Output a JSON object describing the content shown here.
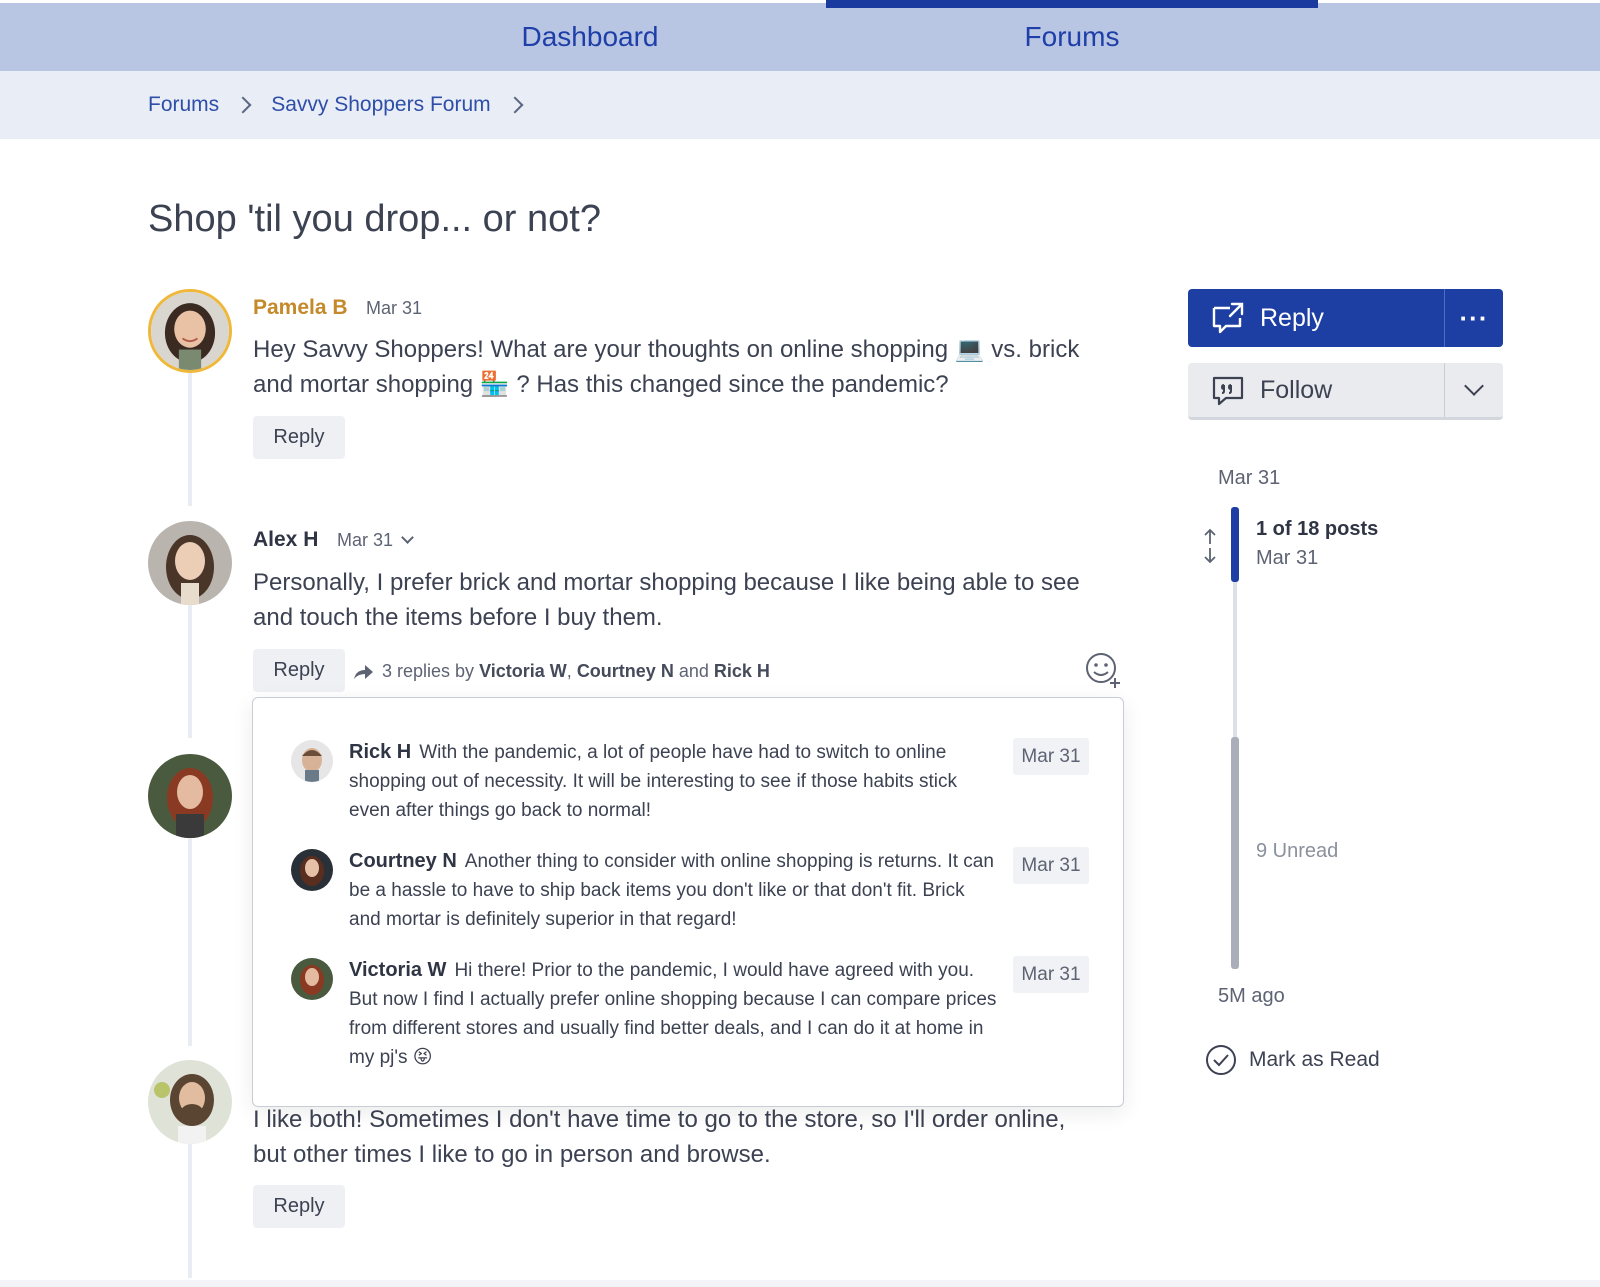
{
  "nav": {
    "tabs": [
      {
        "label": "Dashboard",
        "active": false
      },
      {
        "label": "Forums",
        "active": true
      }
    ]
  },
  "breadcrumb": [
    "Forums",
    "Savvy Shoppers Forum"
  ],
  "thread": {
    "title": "Shop 'til you drop... or not?"
  },
  "posts": [
    {
      "author": "Pamela B",
      "date": "Mar 31",
      "body_line1": "Hey Savvy Shoppers! What are your thoughts on online shopping 💻 vs. brick",
      "body_line2": "and mortar shopping 🏪 ? Has this changed since the pandemic?",
      "reply_label": "Reply"
    },
    {
      "author": "Alex H",
      "date": "Mar 31",
      "body_line1": "Personally, I prefer brick and mortar shopping because I like being able to see",
      "body_line2": "and touch the items before I buy them.",
      "reply_label": "Reply",
      "replies_summary": {
        "prefix": "3 replies by",
        "names": [
          "Victoria W",
          "Courtney N",
          "Rick H"
        ],
        "comma": ",",
        "and": "and"
      }
    },
    {
      "body_line1": "I like both! Sometimes I don't have time to go to the store, so I'll order online,",
      "body_line2": "but other times I like to go in person and browse.",
      "reply_label": "Reply"
    }
  ],
  "replies": [
    {
      "author": "Rick H",
      "text": "With the pandemic, a lot of people have had to switch to online shopping out of necessity. It will be interesting to see if those habits stick even after things go back to normal!",
      "date": "Mar 31"
    },
    {
      "author": "Courtney N",
      "text": "Another thing to consider with online shopping is returns. It can be a hassle to have to ship back items you don't like or that don't fit. Brick and mortar is definitely superior in that regard!",
      "date": "Mar 31"
    },
    {
      "author": "Victoria W",
      "text": "Hi there! Prior to the pandemic, I would have agreed with you. But now I find I actually prefer online shopping because I can compare prices from different stores and usually find better deals, and I can do it at home in my pj's 😝",
      "date": "Mar 31"
    }
  ],
  "sidebar": {
    "reply_label": "Reply",
    "more_label": "···",
    "follow_label": "Follow",
    "timeline": {
      "start_date": "Mar 31",
      "posts_label": "1 of 18 posts",
      "posts_date": "Mar 31",
      "unread_label": "9 Unread",
      "end_date": "5M ago"
    },
    "mark_read_label": "Mark as Read"
  },
  "colors": {
    "accent": "#1d3fa3",
    "nav_bg": "#b8c5e3",
    "breadcrumb_bg": "#e8edf6",
    "op_author": "#c48a2a"
  }
}
